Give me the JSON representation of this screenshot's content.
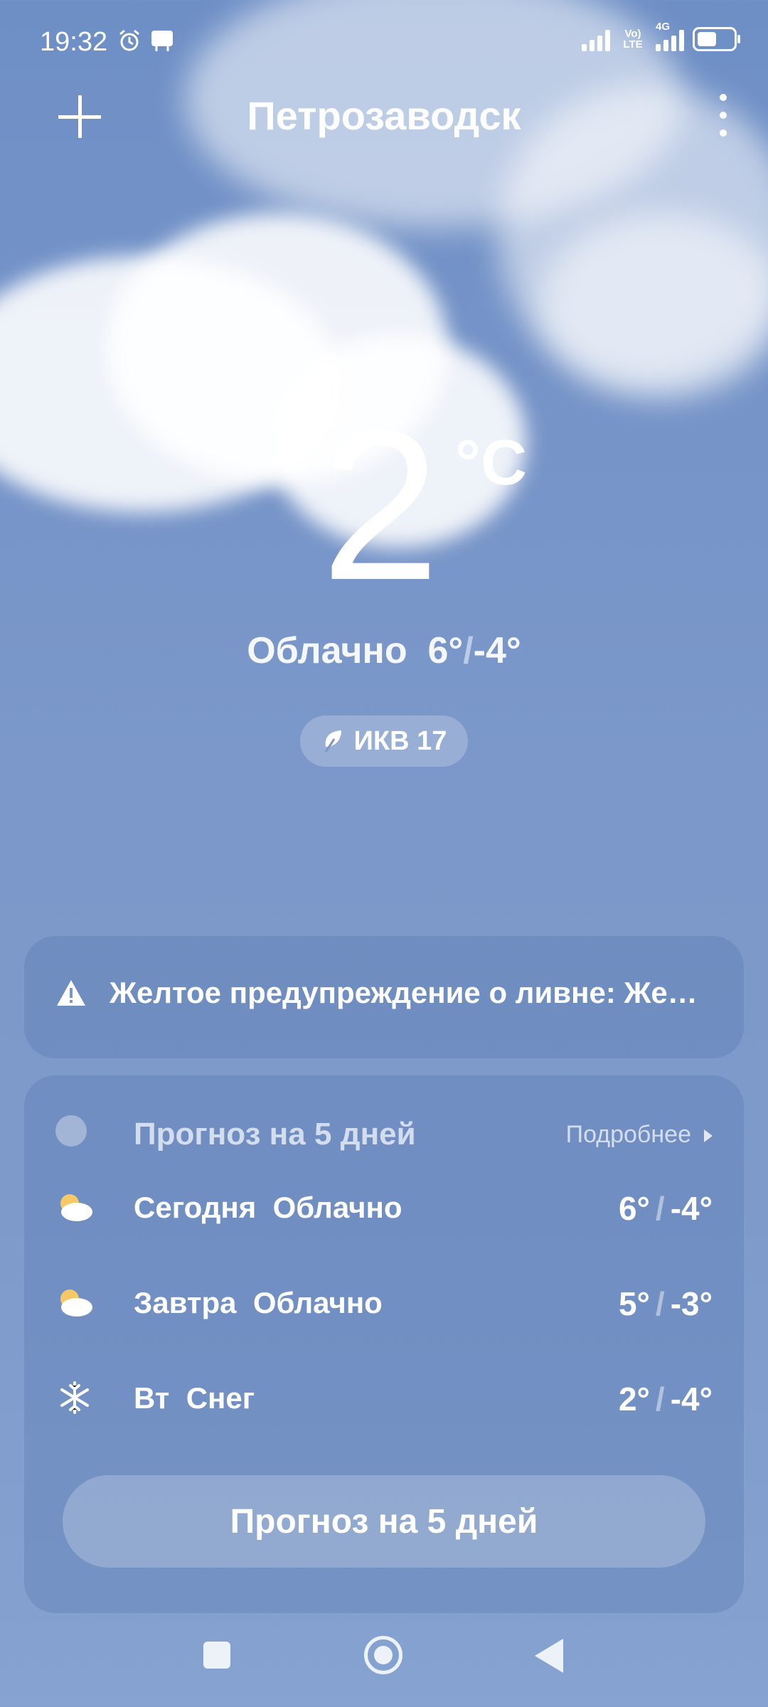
{
  "status_bar": {
    "time": "19:32",
    "network_tag": "Vo) LTE",
    "network_tag2": "4G",
    "battery_level": 0.6
  },
  "header": {
    "city": "Петрозаводск"
  },
  "current": {
    "temperature": "2",
    "unit": "°C",
    "condition": "Облачно",
    "high": "6°",
    "low": "-4°",
    "aqi_label": "ИКВ 17"
  },
  "warning": {
    "text": "Желтое предупреждение о ливне: Желтое предупреждение о ливне"
  },
  "forecast": {
    "title": "Прогноз на 5 дней",
    "more_label": "Подробнее",
    "rows": [
      {
        "day": "Сегодня",
        "condition": "Облачно",
        "high": "6°",
        "low": "-4°",
        "icon": "cloudy-icon"
      },
      {
        "day": "Завтра",
        "condition": "Облачно",
        "high": "5°",
        "low": "-3°",
        "icon": "cloudy-icon"
      },
      {
        "day": "Вт",
        "condition": "Снег",
        "high": "2°",
        "low": "-4°",
        "icon": "snow-icon"
      }
    ],
    "button_label": "Прогноз на 5 дней"
  }
}
